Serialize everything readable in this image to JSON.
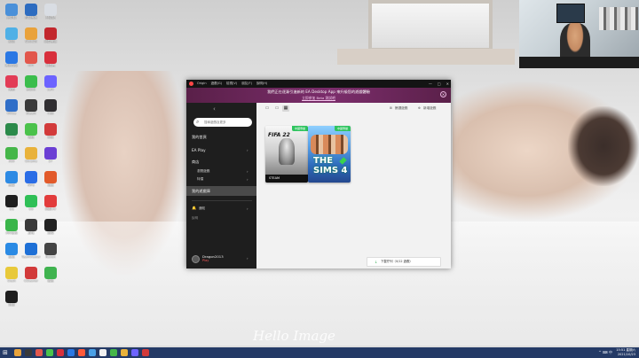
{
  "desktop": {
    "icons": [
      {
        "label": "此电脑",
        "color": "#4a90d9"
      },
      {
        "label": "控制面板",
        "color": "#2d6cc0"
      },
      {
        "label": "回收站",
        "color": "#d9dde3"
      },
      {
        "label": "网络",
        "color": "#4fb0e6"
      },
      {
        "label": "WinRAR",
        "color": "#e9a23b"
      },
      {
        "label": "网易有道",
        "color": "#c2272d"
      },
      {
        "label": "腾讯会议",
        "color": "#2b78e4"
      },
      {
        "label": "PPT",
        "color": "#e2574c"
      },
      {
        "label": "网易云",
        "color": "#d8303c"
      },
      {
        "label": "优酷",
        "color": "#e23c56"
      },
      {
        "label": "爱奇艺",
        "color": "#3bbd4c"
      },
      {
        "label": "Lark",
        "color": "#6c63ff"
      },
      {
        "label": "Office",
        "color": "#2f6ec8"
      },
      {
        "label": "Steam",
        "color": "#3a3a3a"
      },
      {
        "label": "OBS",
        "color": "#302e31"
      },
      {
        "label": "Excel",
        "color": "#2b8a4a"
      },
      {
        "label": "微信",
        "color": "#4bc24b"
      },
      {
        "label": "网易",
        "color": "#d23a3a"
      },
      {
        "label": "360",
        "color": "#45b649"
      },
      {
        "label": "Chrome",
        "color": "#e9b23b"
      },
      {
        "label": "27",
        "color": "#6b3fd4"
      },
      {
        "label": "迅雷",
        "color": "#2d8ae4"
      },
      {
        "label": "WPS",
        "color": "#2a6de6"
      },
      {
        "label": "百度",
        "color": "#e25a2a"
      },
      {
        "label": "QQ",
        "color": "#1e1e1e"
      },
      {
        "label": "UU",
        "color": "#2fbf56"
      },
      {
        "label": "网易UU",
        "color": "#e23c3c"
      },
      {
        "label": "360安全",
        "color": "#3ab54a"
      },
      {
        "label": "游戏",
        "color": "#3a3a3a"
      },
      {
        "label": "剪映",
        "color": "#222"
      },
      {
        "label": "驱动",
        "color": "#2a8ae4"
      },
      {
        "label": "TeamViewer",
        "color": "#1e70d6"
      },
      {
        "label": "Notion",
        "color": "#444"
      },
      {
        "label": "Clash",
        "color": "#e8c93a"
      },
      {
        "label": "CCleaner",
        "color": "#d23a3a"
      },
      {
        "label": "微信",
        "color": "#3fb34f"
      },
      {
        "label": "剪辑",
        "color": "#1e1e1e"
      }
    ]
  },
  "app": {
    "menu": [
      "Origin",
      "遊戲(G)",
      "檢視(V)",
      "朋友(F)",
      "說明(H)"
    ],
    "controls": [
      "—",
      "□",
      "✕"
    ],
    "banner": {
      "line1": "我們正在逐漸引進新的 EA Desktop App 來升級您的遊戲體驗",
      "line2": "立即參加 Beta 測試吧"
    },
    "back": "‹",
    "search_placeholder": "搜尋遊戲及更多",
    "nav": {
      "home": "我的首頁",
      "ea_play": "EA Play",
      "store": "商店",
      "browse": "瀏覽遊戲",
      "deals": "特價",
      "library": "我的遊戲庫",
      "notifications": "通知",
      "help": "說明"
    },
    "user": {
      "name": "Dragon2013",
      "tag": "Play"
    },
    "toolbar": {
      "filter": "篩選遊戲",
      "add_game": "新增遊戲"
    },
    "games": [
      {
        "title": "FIFA 22",
        "badge": "中國專屬",
        "store": "STEAM"
      },
      {
        "title": "THE SIMS 4",
        "badge": "中國專屬",
        "store": ""
      }
    ],
    "download": "下載佇列（0/12 遊戲）"
  },
  "taskbar": {
    "start": "⊞",
    "tray": "^ ⌨ 中",
    "time": "15:51 星期六",
    "date": "2021/10/23",
    "app_colors": [
      "#e8a33b",
      "#3a3a3a",
      "#e2574c",
      "#4bc24b",
      "#d8303c",
      "#2b78e4",
      "#ff5a3a",
      "#4aa0e6",
      "#f0f0f0",
      "#45b649",
      "#e9b23b",
      "#6c63ff",
      "#d23a3a"
    ]
  },
  "wallpaper": {
    "watermark": "Hello Image"
  }
}
